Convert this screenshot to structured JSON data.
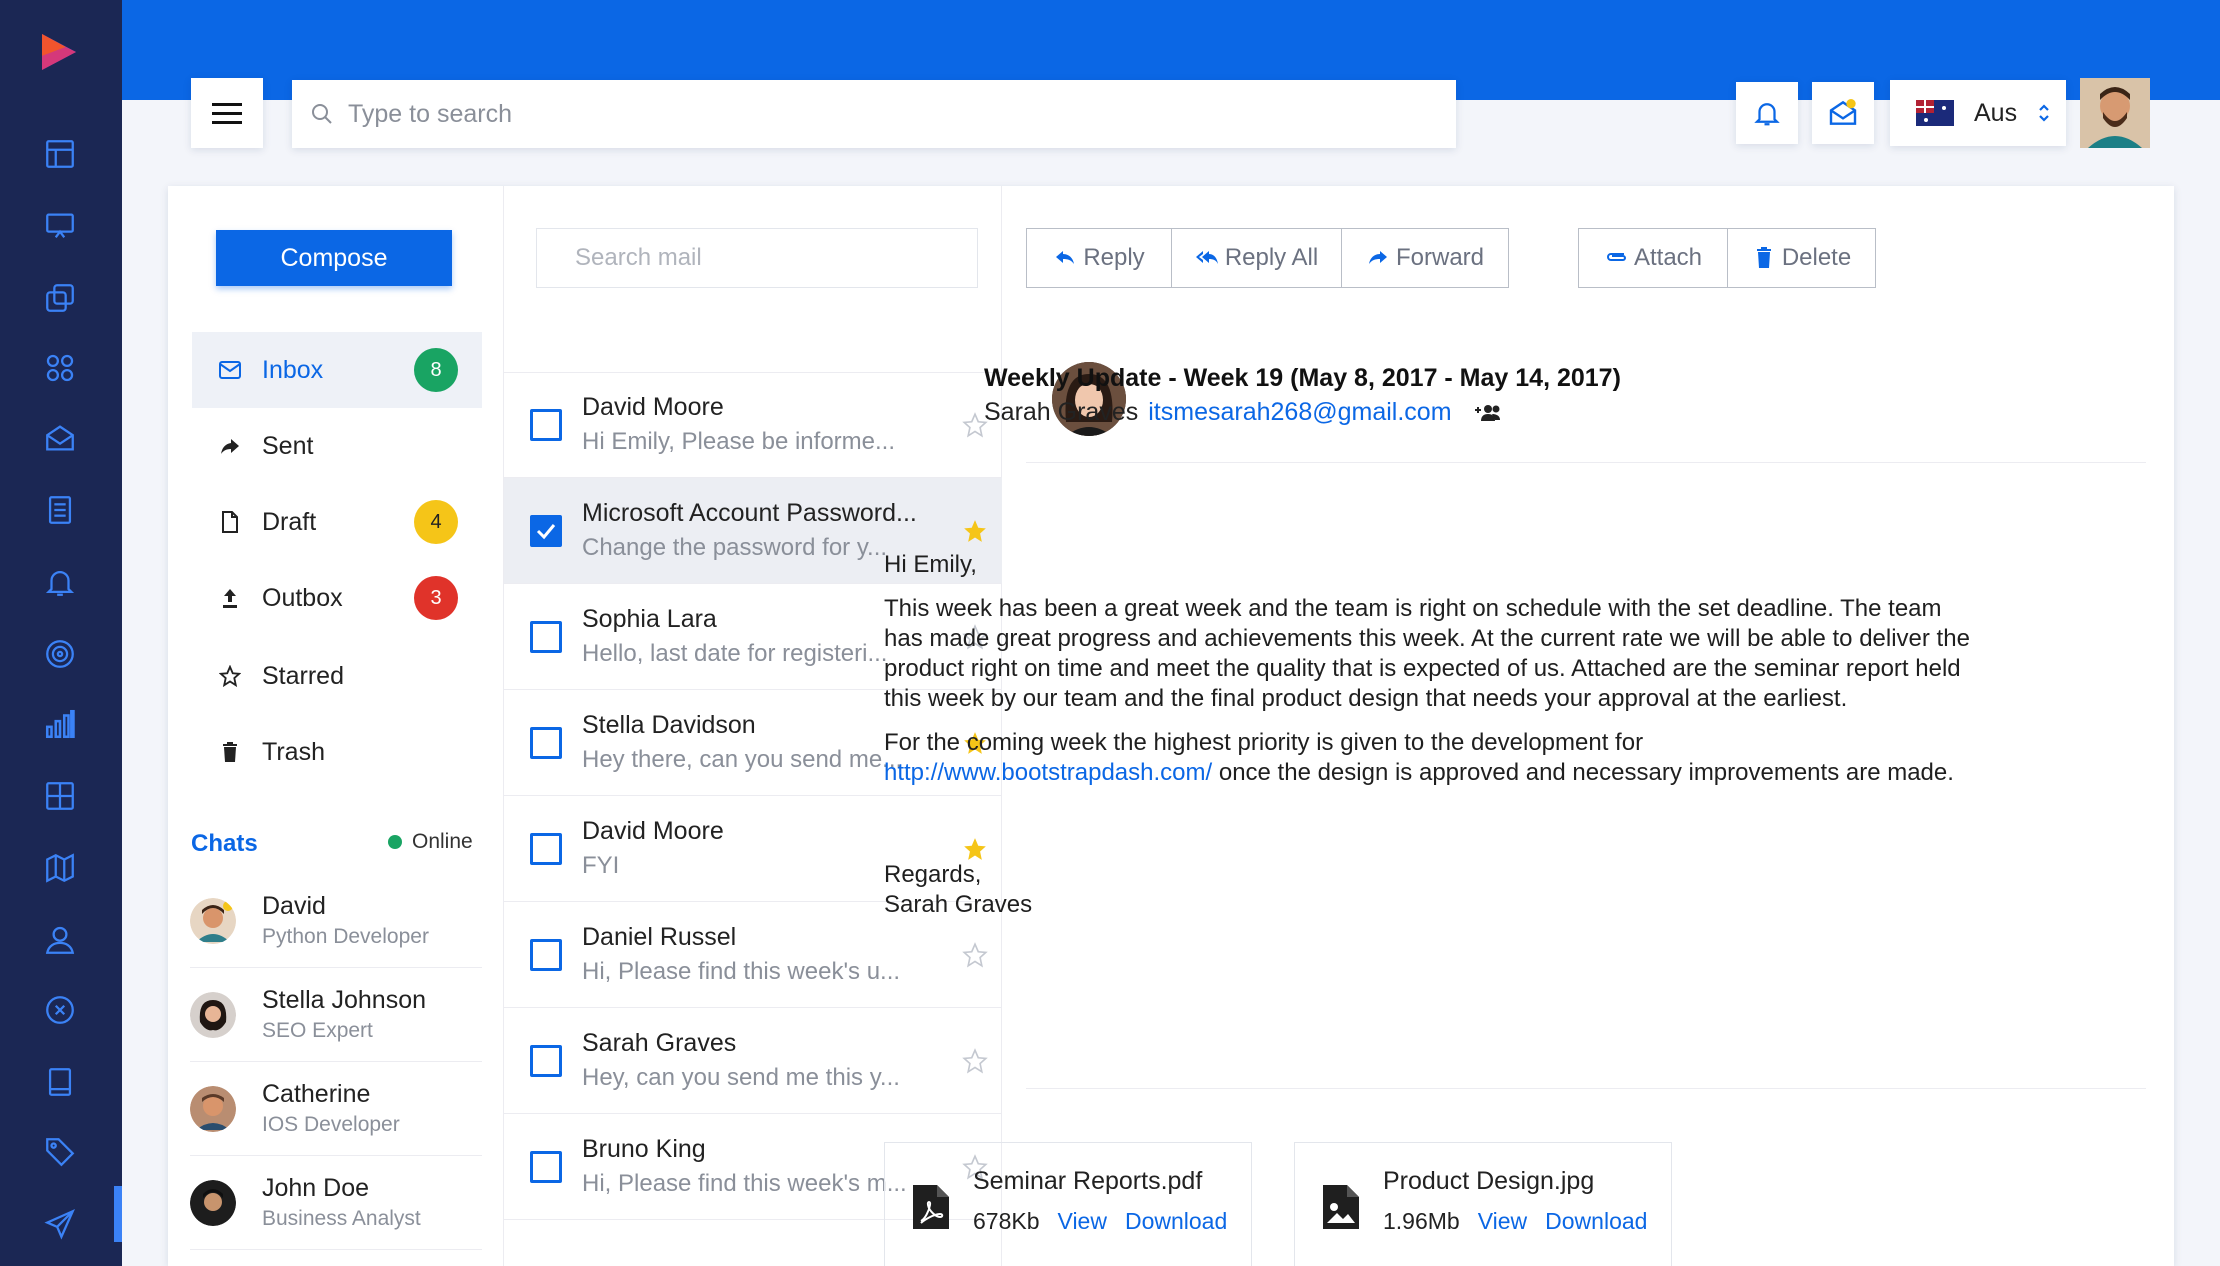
{
  "header": {
    "search_placeholder": "Type to search",
    "language": "Aus"
  },
  "folders": {
    "compose": "Compose",
    "items": [
      {
        "label": "Inbox",
        "badge": "8",
        "badge_color": "#19a463",
        "active": true
      },
      {
        "label": "Sent",
        "badge": ""
      },
      {
        "label": "Draft",
        "badge": "4",
        "badge_color": "#f5c518"
      },
      {
        "label": "Outbox",
        "badge": "3",
        "badge_color": "#e0332a"
      },
      {
        "label": "Starred",
        "badge": ""
      },
      {
        "label": "Trash",
        "badge": ""
      }
    ]
  },
  "chats": {
    "title": "Chats",
    "status": "Online",
    "people": [
      {
        "name": "David",
        "role": "Python Developer"
      },
      {
        "name": "Stella Johnson",
        "role": "SEO Expert"
      },
      {
        "name": "Catherine",
        "role": "IOS Developer"
      },
      {
        "name": "John Doe",
        "role": "Business Analyst"
      }
    ]
  },
  "mail_list": {
    "search_placeholder": "Search mail",
    "items": [
      {
        "from": "David Moore",
        "snippet": "Hi Emily, Please be informe...",
        "checked": false,
        "starred": false
      },
      {
        "from": "Microsoft Account Password...",
        "snippet": "Change the password for y...",
        "checked": true,
        "starred": true
      },
      {
        "from": "Sophia Lara",
        "snippet": "Hello, last date for registeri...",
        "checked": false,
        "starred": false
      },
      {
        "from": "Stella Davidson",
        "snippet": "Hey there, can you send me...",
        "checked": false,
        "starred": true
      },
      {
        "from": "David Moore",
        "snippet": "FYI",
        "checked": false,
        "starred": true
      },
      {
        "from": "Daniel Russel",
        "snippet": "Hi, Please find this week's u...",
        "checked": false,
        "starred": false
      },
      {
        "from": "Sarah Graves",
        "snippet": "Hey, can you send me this y...",
        "checked": false,
        "starred": false
      },
      {
        "from": "Bruno King",
        "snippet": "Hi, Please find this week's m...",
        "checked": false,
        "starred": false
      }
    ]
  },
  "toolbar": {
    "reply": "Reply",
    "reply_all": "Reply All",
    "forward": "Forward",
    "attach": "Attach",
    "delete": "Delete"
  },
  "message": {
    "subject": "Weekly Update - Week 19 (May 8, 2017 - May 14, 2017)",
    "sender_name": "Sarah Graves",
    "sender_email": "itsmesarah268@gmail.com",
    "greeting": "Hi Emily,",
    "para1": "This week has been a great week and the team is right on schedule with the set deadline. The team has made great progress and achievements this week. At the current rate we will be able to deliver the product right on time and meet the quality that is expected of us. Attached are the seminar report held this week by our team and the final product design that needs your approval at the earliest.",
    "para2_before": "For the coming week the highest priority is given to the development for",
    "para2_link": "http://www.bootstrapdash.com/",
    "para2_after": " once the design is approved and necessary improvements are made.",
    "regards": "Regards,",
    "signature": "Sarah Graves"
  },
  "attachments": [
    {
      "name": "Seminar Reports.pdf",
      "size": "678Kb",
      "view": "View",
      "download": "Download",
      "icon": "pdf-file-icon"
    },
    {
      "name": "Product Design.jpg",
      "size": "1.96Mb",
      "view": "View",
      "download": "Download",
      "icon": "image-file-icon"
    }
  ],
  "colors": {
    "primary": "#0b67e5",
    "sidebar": "#1b2754",
    "star": "#f5c518"
  }
}
